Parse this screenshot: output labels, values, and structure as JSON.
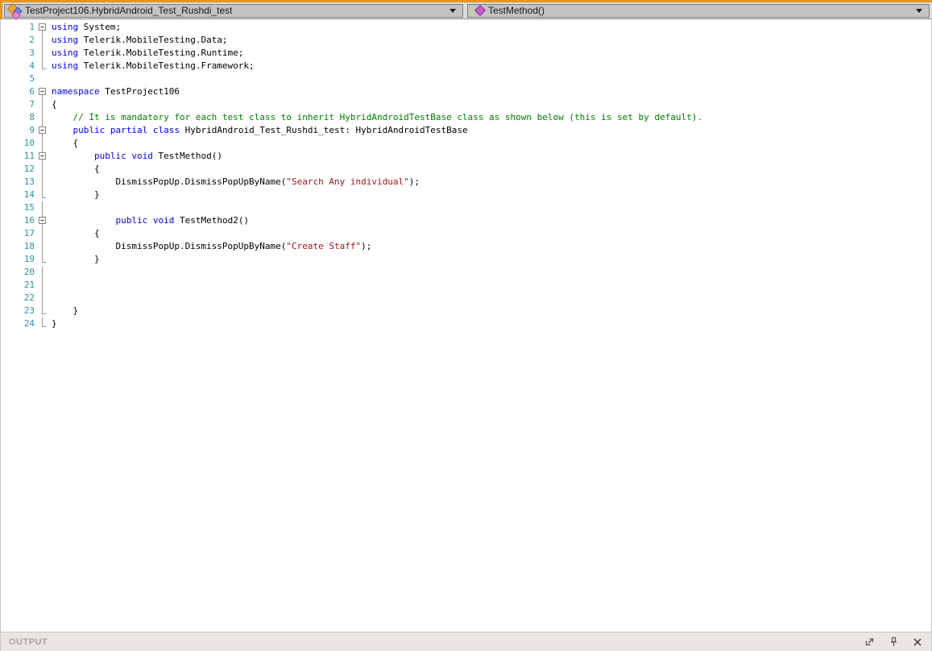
{
  "colors": {
    "accent": "#E6951F",
    "keyword": "#0000FF",
    "comment": "#008000",
    "string": "#A31515",
    "line_number": "#2B91AF"
  },
  "nav": {
    "class_dropdown": {
      "label": "TestProject106.HybridAndroid_Test_Rushdi_test",
      "icon": "class-icon"
    },
    "method_dropdown": {
      "label": "TestMethod()",
      "icon": "method-icon"
    }
  },
  "editor": {
    "language": "csharp",
    "lines": [
      {
        "n": 1,
        "fold": "box",
        "code": [
          [
            "k",
            "using"
          ],
          [
            "n",
            " System;"
          ]
        ]
      },
      {
        "n": 2,
        "fold": "line",
        "code": [
          [
            "k",
            "using"
          ],
          [
            "n",
            " Telerik.MobileTesting.Data;"
          ]
        ]
      },
      {
        "n": 3,
        "fold": "line",
        "code": [
          [
            "k",
            "using"
          ],
          [
            "n",
            " Telerik.MobileTesting.Runtime;"
          ]
        ]
      },
      {
        "n": 4,
        "fold": "end",
        "code": [
          [
            "k",
            "using"
          ],
          [
            "n",
            " Telerik.MobileTesting.Framework;"
          ]
        ]
      },
      {
        "n": 5,
        "fold": "",
        "code": []
      },
      {
        "n": 6,
        "fold": "box",
        "code": [
          [
            "k",
            "namespace"
          ],
          [
            "n",
            " TestProject106"
          ]
        ]
      },
      {
        "n": 7,
        "fold": "line",
        "code": [
          [
            "n",
            "{"
          ]
        ]
      },
      {
        "n": 8,
        "fold": "line",
        "code": [
          [
            "c",
            "    // It is mandatory for each test class to inherit HybridAndroidTestBase class as shown below (this is set by default)."
          ]
        ]
      },
      {
        "n": 9,
        "fold": "boxmid",
        "code": [
          [
            "n",
            "    "
          ],
          [
            "k",
            "public"
          ],
          [
            "n",
            " "
          ],
          [
            "k",
            "partial"
          ],
          [
            "n",
            " "
          ],
          [
            "k",
            "class"
          ],
          [
            "n",
            " HybridAndroid_Test_Rushdi_test: HybridAndroidTestBase"
          ]
        ]
      },
      {
        "n": 10,
        "fold": "line",
        "code": [
          [
            "n",
            "    {"
          ]
        ]
      },
      {
        "n": 11,
        "fold": "boxmid",
        "code": [
          [
            "n",
            "        "
          ],
          [
            "k",
            "public"
          ],
          [
            "n",
            " "
          ],
          [
            "k",
            "void"
          ],
          [
            "n",
            " TestMethod()"
          ]
        ]
      },
      {
        "n": 12,
        "fold": "line",
        "code": [
          [
            "n",
            "        {"
          ]
        ]
      },
      {
        "n": 13,
        "fold": "line",
        "code": [
          [
            "n",
            "            DismissPopUp.DismissPopUpByName("
          ],
          [
            "s",
            "\"Search Any individual\""
          ],
          [
            "n",
            ");"
          ]
        ]
      },
      {
        "n": 14,
        "fold": "end",
        "code": [
          [
            "n",
            "        }"
          ]
        ]
      },
      {
        "n": 15,
        "fold": "line",
        "code": []
      },
      {
        "n": 16,
        "fold": "boxmid",
        "code": [
          [
            "n",
            "            "
          ],
          [
            "k",
            "public"
          ],
          [
            "n",
            " "
          ],
          [
            "k",
            "void"
          ],
          [
            "n",
            " TestMethod2()"
          ]
        ]
      },
      {
        "n": 17,
        "fold": "line",
        "code": [
          [
            "n",
            "        {"
          ]
        ]
      },
      {
        "n": 18,
        "fold": "line",
        "code": [
          [
            "n",
            "            DismissPopUp.DismissPopUpByName("
          ],
          [
            "s",
            "\"Create Staff\""
          ],
          [
            "n",
            ");"
          ]
        ]
      },
      {
        "n": 19,
        "fold": "end",
        "code": [
          [
            "n",
            "        }"
          ]
        ]
      },
      {
        "n": 20,
        "fold": "line",
        "code": []
      },
      {
        "n": 21,
        "fold": "line",
        "code": []
      },
      {
        "n": 22,
        "fold": "line",
        "code": []
      },
      {
        "n": 23,
        "fold": "end",
        "code": [
          [
            "n",
            "    }"
          ]
        ]
      },
      {
        "n": 24,
        "fold": "end",
        "code": [
          [
            "n",
            "}"
          ]
        ]
      }
    ]
  },
  "output": {
    "title": "OUTPUT",
    "icons": [
      "restore-icon",
      "pin-icon",
      "close-icon"
    ]
  }
}
